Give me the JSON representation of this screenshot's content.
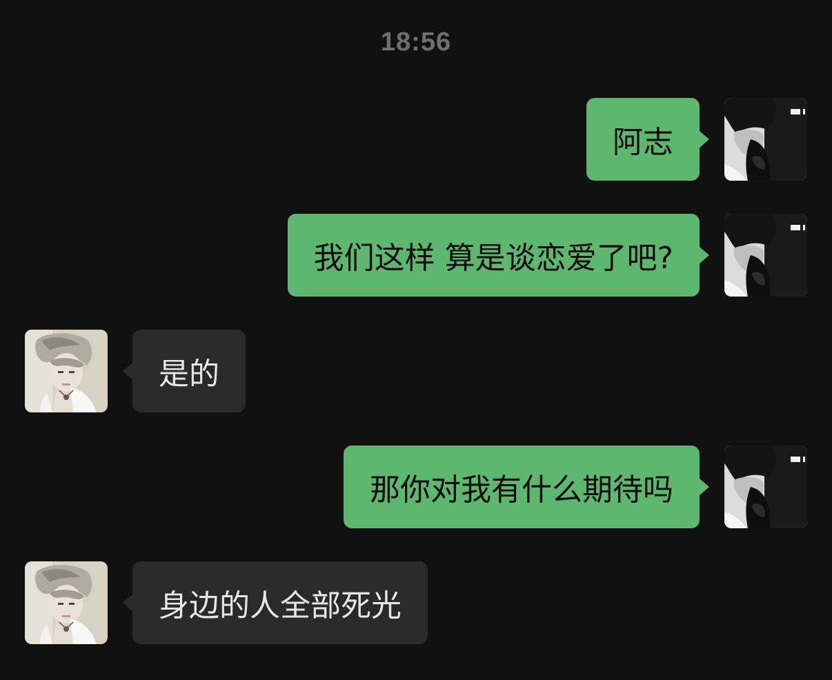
{
  "time": "18:56",
  "colors": {
    "background": "#111111",
    "outgoing_bubble": "#5eb76f",
    "incoming_bubble": "#2a2a2a"
  },
  "messages": [
    {
      "direction": "outgoing",
      "text": "阿志",
      "avatar_icon": "dark-haired-man-avatar-icon"
    },
    {
      "direction": "outgoing",
      "text": "我们这样 算是谈恋爱了吧?",
      "avatar_icon": "dark-haired-man-avatar-icon"
    },
    {
      "direction": "incoming",
      "text": "是的",
      "avatar_icon": "silver-haired-man-avatar-icon"
    },
    {
      "direction": "outgoing",
      "text": "那你对我有什么期待吗",
      "avatar_icon": "dark-haired-man-avatar-icon"
    },
    {
      "direction": "incoming",
      "text": "身边的人全部死光",
      "avatar_icon": "silver-haired-man-avatar-icon"
    }
  ]
}
